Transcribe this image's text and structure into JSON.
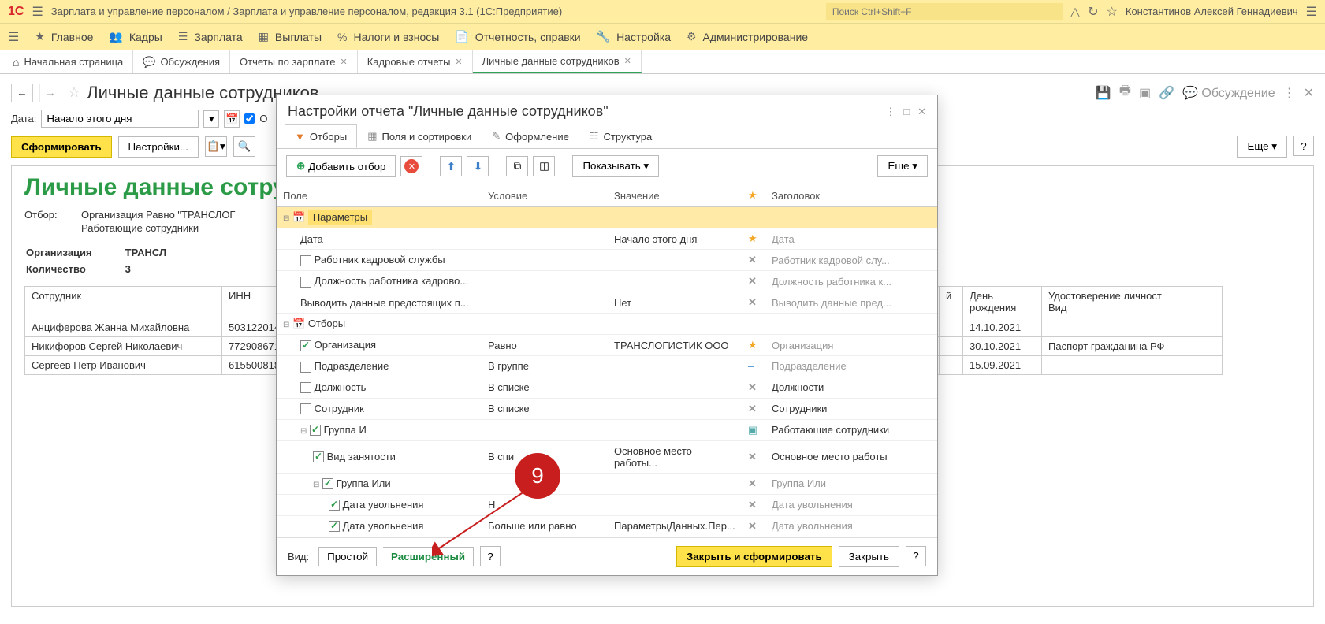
{
  "app": {
    "title": "Зарплата и управление персоналом / Зарплата и управление персоналом, редакция 3.1  (1С:Предприятие)",
    "search_placeholder": "Поиск Ctrl+Shift+F",
    "user": "Константинов Алексей Геннадиевич"
  },
  "main_menu": [
    "Главное",
    "Кадры",
    "Зарплата",
    "Выплаты",
    "Налоги и взносы",
    "Отчетность, справки",
    "Настройка",
    "Администрирование"
  ],
  "tabs": {
    "home": "Начальная страница",
    "discussions": "Обсуждения",
    "t3": "Отчеты по зарплате",
    "t4": "Кадровые отчеты",
    "t5": "Личные данные сотрудников"
  },
  "page": {
    "title": "Личные данные сотрудников",
    "date_label": "Дата:",
    "date_value": "Начало этого дня",
    "chk_label": "О",
    "form_btn": "Сформировать",
    "settings_btn": "Настройки...",
    "more_btn": "Еще",
    "discuss_btn": "Обсуждение"
  },
  "report": {
    "title": "Личные данные сотру",
    "filter_label": "Отбор:",
    "filter_line1": "Организация Равно \"ТРАНСЛОГ",
    "filter_line2": "Работающие сотрудники",
    "org_label": "Организация",
    "org_value": "ТРАНСЛ",
    "count_label": "Количество",
    "count_value": "3",
    "col_emp": "Сотрудник",
    "col_inn": "ИНН",
    "col_ext1": "й",
    "col_day": "День",
    "col_birth": "рождения",
    "col_id": "Удостоверение личност",
    "col_kind": "Вид",
    "rows": [
      {
        "name": "Анциферова Жанна Михайловна",
        "inn": "503122014",
        "birth": "14.10.2021",
        "doc": ""
      },
      {
        "name": "Никифоров Сергей Николаевич",
        "inn": "772908671",
        "birth": "30.10.2021",
        "doc": "Паспорт гражданина РФ"
      },
      {
        "name": "Сергеев Петр Иванович",
        "inn": "615500818",
        "birth": "15.09.2021",
        "doc": ""
      }
    ]
  },
  "modal": {
    "title": "Настройки отчета \"Личные данные сотрудников\"",
    "tabs": {
      "filters": "Отборы",
      "fields": "Поля и сортировки",
      "style": "Оформление",
      "struct": "Структура"
    },
    "toolbar": {
      "add": "Добавить отбор",
      "show": "Показывать",
      "more": "Еще"
    },
    "cols": {
      "field": "Поле",
      "cond": "Условие",
      "value": "Значение",
      "star": "★",
      "header": "Заголовок"
    },
    "rows": {
      "params": "Параметры",
      "date": {
        "field": "Дата",
        "value": "Начало этого дня",
        "mark": "★",
        "header": "Дата"
      },
      "hr_worker": {
        "field": "Работник кадровой службы",
        "mark": "✕",
        "header": "Работник кадровой слу..."
      },
      "hr_pos": {
        "field": "Должность работника кадрово...",
        "mark": "✕",
        "header": "Должность работника к..."
      },
      "upcoming": {
        "field": "Выводить данные предстоящих п...",
        "value": "Нет",
        "mark": "✕",
        "header": "Выводить данные пред..."
      },
      "filters": "Отборы",
      "org": {
        "field": "Организация",
        "cond": "Равно",
        "value": "ТРАНСЛОГИСТИК ООО",
        "mark": "★",
        "header": "Организация"
      },
      "dept": {
        "field": "Подразделение",
        "cond": "В группе",
        "mark": "–",
        "header": "Подразделение"
      },
      "position": {
        "field": "Должность",
        "cond": "В списке",
        "mark": "✕",
        "header": "Должности"
      },
      "employee": {
        "field": "Сотрудник",
        "cond": "В списке",
        "mark": "✕",
        "header": "Сотрудники"
      },
      "group_and": {
        "field": "Группа И",
        "header": "Работающие сотрудники"
      },
      "emp_type": {
        "field": "Вид занятости",
        "cond": "В спи",
        "value": "Основное место работы...",
        "mark": "✕",
        "header": "Основное место работы"
      },
      "group_or": {
        "field": "Группа Или",
        "mark": "✕",
        "header": "Группа Или"
      },
      "fire1": {
        "field": "Дата увольнения",
        "cond": "Н",
        "mark": "✕",
        "header": "Дата увольнения"
      },
      "fire2": {
        "field": "Дата увольнения",
        "cond": "Больше или равно",
        "value": "ПараметрыДанных.Пер...",
        "mark": "✕",
        "header": "Дата увольнения"
      }
    },
    "footer": {
      "view_label": "Вид:",
      "simple": "Простой",
      "extended": "Расширенный",
      "close_form": "Закрыть и сформировать",
      "close": "Закрыть"
    }
  },
  "annotation": {
    "num": "9"
  }
}
